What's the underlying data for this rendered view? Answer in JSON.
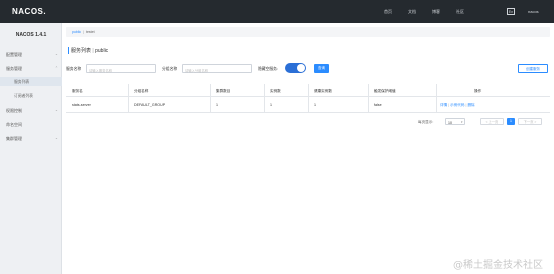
{
  "app": {
    "logo": "NACOS.",
    "version": "NACOS 1.4.1"
  },
  "topnav": [
    {
      "label": "首页"
    },
    {
      "label": "文档"
    },
    {
      "label": "博客"
    },
    {
      "label": "社区"
    }
  ],
  "lang": "En",
  "user": "nacos",
  "sidebar": {
    "items": [
      {
        "label": "配置管理"
      },
      {
        "label": "服务管理"
      },
      {
        "label": "服务列表"
      },
      {
        "label": "订阅者列表"
      },
      {
        "label": "权限控制"
      },
      {
        "label": "命名空间"
      },
      {
        "label": "集群管理"
      }
    ]
  },
  "namespace": {
    "active": "public",
    "separator": "|",
    "other": "testet"
  },
  "page": {
    "title": "服务列表",
    "separator": "|",
    "namespace": "public"
  },
  "filters": {
    "service_label": "服务名称",
    "service_placeholder": "请输入服务名称",
    "group_label": "分组名称",
    "group_placeholder": "请输入分组名称",
    "hide_empty_label": "隐藏空服务:",
    "hide_empty_on": true,
    "query_button": "查询",
    "create_button": "创建服务"
  },
  "table": {
    "headers": [
      "服务名",
      "分组名称",
      "集群数目",
      "实例数",
      "健康实例数",
      "触发保护阈值",
      "操作"
    ],
    "rows": [
      {
        "service": "stats-server",
        "group": "DEFAULT_GROUP",
        "clusters": "1",
        "instances": "1",
        "healthy": "1",
        "threshold": "false",
        "op_detail": "详情",
        "op_sample": "示例代码",
        "op_delete": "删除",
        "op_sep": "|"
      }
    ]
  },
  "pager": {
    "page_size_label": "每页显示:",
    "page_size": "10",
    "prev": "< 上一页",
    "current": "1",
    "next": "下一页 >"
  },
  "watermark": "@稀土掘金技术社区"
}
